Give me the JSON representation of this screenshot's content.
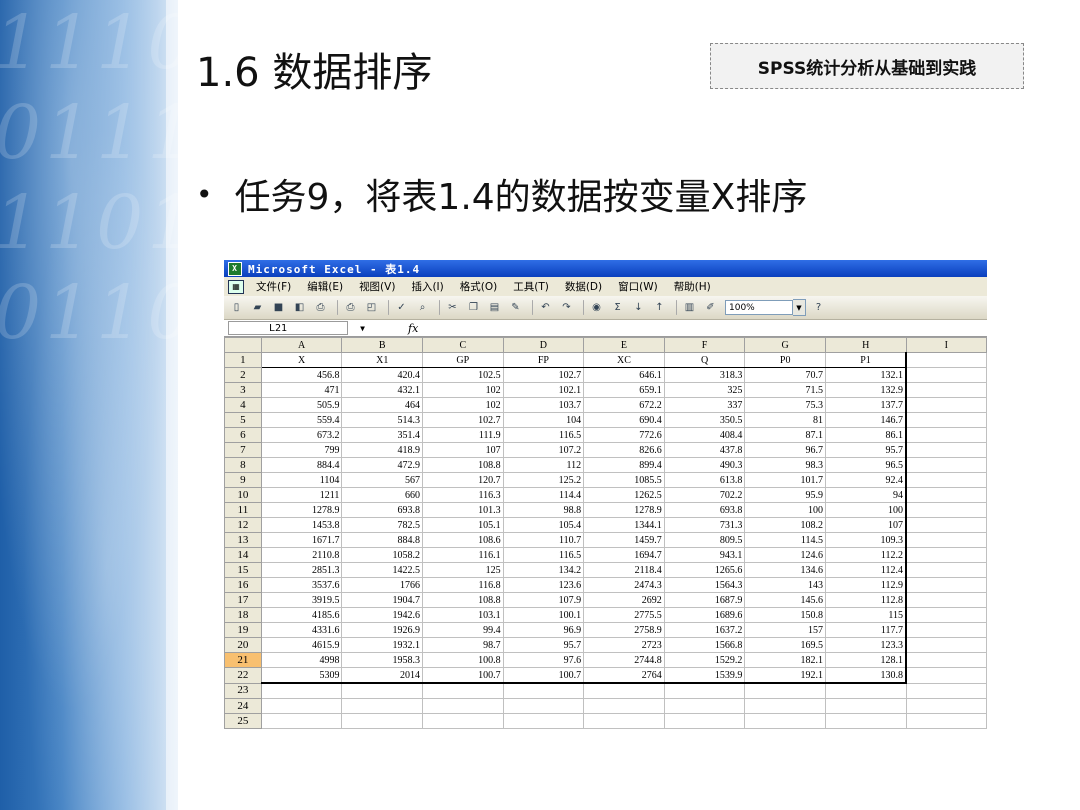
{
  "slide": {
    "title": "1.6  数据排序",
    "badge": "SPSS统计分析从基础到实践",
    "bullet": "任务9，将表1.4的数据按变量X排序"
  },
  "excel": {
    "window_title": "Microsoft Excel - 表1.4",
    "menu": [
      "文件(F)",
      "编辑(E)",
      "视图(V)",
      "插入(I)",
      "格式(O)",
      "工具(T)",
      "数据(D)",
      "窗口(W)",
      "帮助(H)"
    ],
    "zoom": "100%",
    "name_box": "L21",
    "fx_label": "fx",
    "columns": [
      "A",
      "B",
      "C",
      "D",
      "E",
      "F",
      "G",
      "H",
      "I"
    ],
    "selected_row": "21",
    "header_row": [
      "X",
      "X1",
      "GP",
      "FP",
      "XC",
      "Q",
      "P0",
      "P1"
    ],
    "rows": [
      [
        "456.8",
        "420.4",
        "102.5",
        "102.7",
        "646.1",
        "318.3",
        "70.7",
        "132.1"
      ],
      [
        "471",
        "432.1",
        "102",
        "102.1",
        "659.1",
        "325",
        "71.5",
        "132.9"
      ],
      [
        "505.9",
        "464",
        "102",
        "103.7",
        "672.2",
        "337",
        "75.3",
        "137.7"
      ],
      [
        "559.4",
        "514.3",
        "102.7",
        "104",
        "690.4",
        "350.5",
        "81",
        "146.7"
      ],
      [
        "673.2",
        "351.4",
        "111.9",
        "116.5",
        "772.6",
        "408.4",
        "87.1",
        "86.1"
      ],
      [
        "799",
        "418.9",
        "107",
        "107.2",
        "826.6",
        "437.8",
        "96.7",
        "95.7"
      ],
      [
        "884.4",
        "472.9",
        "108.8",
        "112",
        "899.4",
        "490.3",
        "98.3",
        "96.5"
      ],
      [
        "1104",
        "567",
        "120.7",
        "125.2",
        "1085.5",
        "613.8",
        "101.7",
        "92.4"
      ],
      [
        "1211",
        "660",
        "116.3",
        "114.4",
        "1262.5",
        "702.2",
        "95.9",
        "94"
      ],
      [
        "1278.9",
        "693.8",
        "101.3",
        "98.8",
        "1278.9",
        "693.8",
        "100",
        "100"
      ],
      [
        "1453.8",
        "782.5",
        "105.1",
        "105.4",
        "1344.1",
        "731.3",
        "108.2",
        "107"
      ],
      [
        "1671.7",
        "884.8",
        "108.6",
        "110.7",
        "1459.7",
        "809.5",
        "114.5",
        "109.3"
      ],
      [
        "2110.8",
        "1058.2",
        "116.1",
        "116.5",
        "1694.7",
        "943.1",
        "124.6",
        "112.2"
      ],
      [
        "2851.3",
        "1422.5",
        "125",
        "134.2",
        "2118.4",
        "1265.6",
        "134.6",
        "112.4"
      ],
      [
        "3537.6",
        "1766",
        "116.8",
        "123.6",
        "2474.3",
        "1564.3",
        "143",
        "112.9"
      ],
      [
        "3919.5",
        "1904.7",
        "108.8",
        "107.9",
        "2692",
        "1687.9",
        "145.6",
        "112.8"
      ],
      [
        "4185.6",
        "1942.6",
        "103.1",
        "100.1",
        "2775.5",
        "1689.6",
        "150.8",
        "115"
      ],
      [
        "4331.6",
        "1926.9",
        "99.4",
        "96.9",
        "2758.9",
        "1637.2",
        "157",
        "117.7"
      ],
      [
        "4615.9",
        "1932.1",
        "98.7",
        "95.7",
        "2723",
        "1566.8",
        "169.5",
        "123.3"
      ],
      [
        "4998",
        "1958.3",
        "100.8",
        "97.6",
        "2744.8",
        "1529.2",
        "182.1",
        "128.1"
      ],
      [
        "5309",
        "2014",
        "100.7",
        "100.7",
        "2764",
        "1539.9",
        "192.1",
        "130.8"
      ]
    ],
    "empty_rows": [
      "23",
      "24",
      "25"
    ]
  }
}
